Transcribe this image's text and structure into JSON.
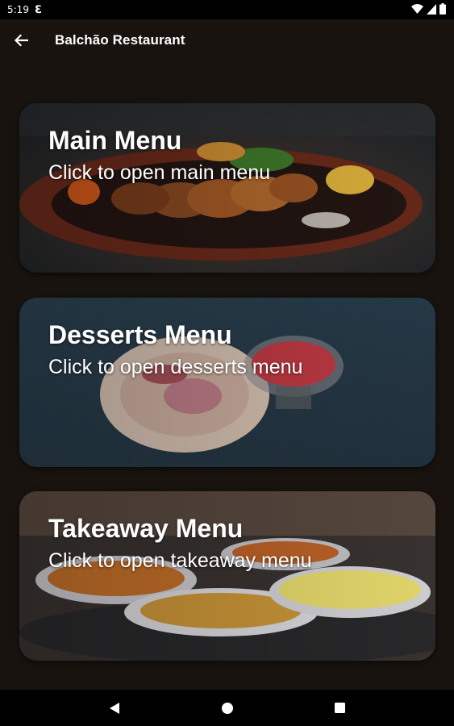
{
  "status_bar": {
    "time": "5:19",
    "notification_glyph": "ℇ",
    "icons": [
      "wifi-icon",
      "signal-icon",
      "battery-icon"
    ]
  },
  "app_bar": {
    "title": "Balchão Restaurant",
    "back_icon": "arrow-back-icon"
  },
  "cards": {
    "main": {
      "title": "Main Menu",
      "subtitle": "Click to open main menu",
      "image": "grilled-skewers-on-sizzling-plate"
    },
    "desserts": {
      "title": "Desserts Menu",
      "subtitle": "Click to open desserts menu",
      "image": "desserts-plate-and-glass"
    },
    "takeaway": {
      "title": "Takeaway Menu",
      "subtitle": "Click to open takeaway menu",
      "image": "curry-dishes-on-platter"
    }
  },
  "nav_bar": {
    "icons": [
      "back-triangle-icon",
      "home-circle-icon",
      "recents-square-icon"
    ]
  },
  "colors": {
    "background": "#18130f",
    "status_bar": "#000000",
    "text": "#ffffff"
  }
}
